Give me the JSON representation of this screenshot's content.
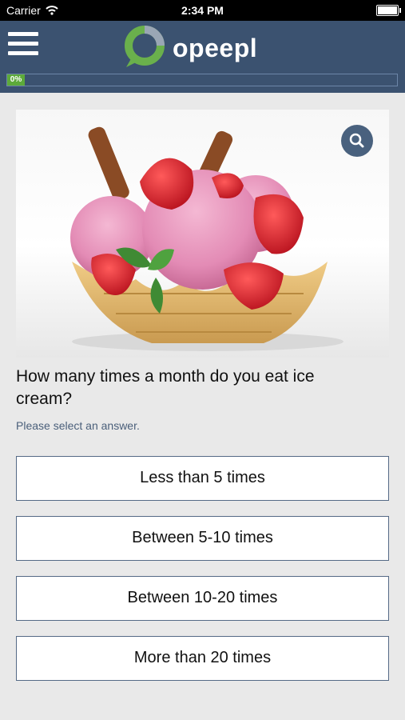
{
  "status_bar": {
    "carrier": "Carrier",
    "time": "2:34 PM"
  },
  "header": {
    "app_name": "opeepl",
    "progress_label": "0%",
    "progress_value": 0,
    "brand_color": "#3b5270",
    "progress_color": "#5daa3a"
  },
  "hero": {
    "image": "ice-cream-waffle-bowl-strawberries",
    "zoom_icon": "search-icon"
  },
  "question": {
    "text": "How many times a month do you eat ice cream?",
    "hint": "Please select an answer."
  },
  "answers": [
    "Less than 5 times",
    "Between 5-10 times",
    "Between 10-20 times",
    "More than 20 times"
  ]
}
